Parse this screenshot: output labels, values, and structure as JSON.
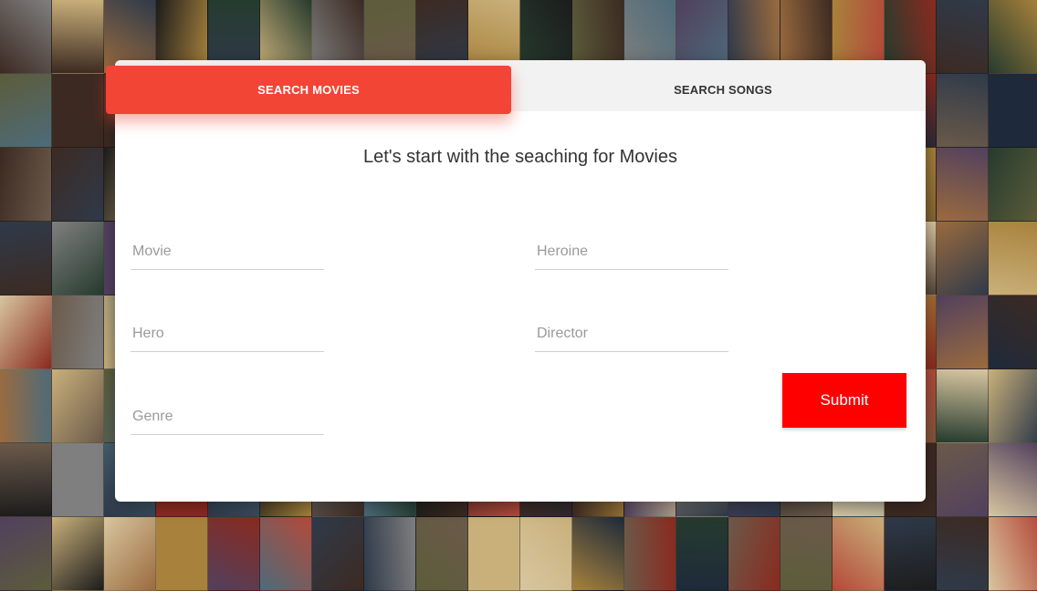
{
  "tabs": {
    "movies_label": "SEARCH MOVIES",
    "songs_label": "SEARCH SONGS",
    "active": "movies"
  },
  "heading": "Let's start with the seaching for Movies",
  "form": {
    "movie_placeholder": "Movie",
    "heroine_placeholder": "Heroine",
    "hero_placeholder": "Hero",
    "director_placeholder": "Director",
    "genre_placeholder": "Genre",
    "submit_label": "Submit"
  },
  "colors": {
    "accent": "#f24536",
    "submit": "#ff0000",
    "card": "#ffffff"
  },
  "background": {
    "description_icon": "movie-poster-wall",
    "tile_colors": [
      "#6b5a4a",
      "#2f3a4a",
      "#8a2a1f",
      "#c9b07a",
      "#1c1c1c",
      "#4d6b7a",
      "#a8823c",
      "#3c2a22",
      "#7f7f7f",
      "#b4493a",
      "#263b2e",
      "#d8c6a0",
      "#51405e",
      "#1e2a3b",
      "#9b6b3e",
      "#5c5c3a"
    ]
  }
}
